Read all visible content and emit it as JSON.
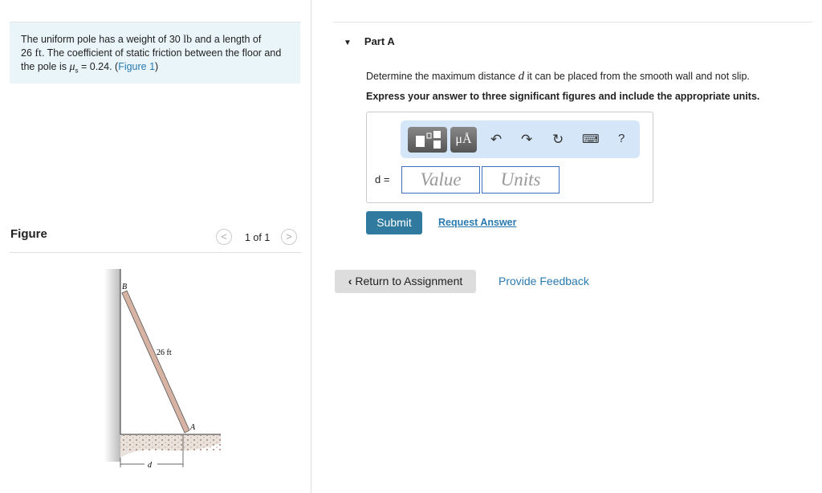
{
  "problem": {
    "p1": "The uniform pole has a weight of 30 ",
    "u1": "lb",
    "p2": " and a length of ",
    "p3": "26 ",
    "u2": "ft",
    "p4": ". The coefficient of static friction between the floor and the pole is ",
    "mu": "μ",
    "sub": "s",
    "p5": " = 0.24. (",
    "figlink": "Figure 1",
    "p6": ")"
  },
  "figure": {
    "label": "Figure",
    "pager": "1 of 1",
    "prev": "<",
    "next": ">",
    "labels": {
      "b": "B",
      "a": "A",
      "length": "26 ft",
      "d": "d"
    }
  },
  "part": {
    "title": "Part A",
    "question_pre": "Determine the maximum distance ",
    "var": "d",
    "question_post": " it can be placed from the smooth wall and not slip.",
    "instruction": "Express your answer to three significant figures and include the appropriate units."
  },
  "answer": {
    "var_label": "d =",
    "value_placeholder": "Value",
    "units_placeholder": "Units",
    "toolbar": {
      "units_btn": "μÅ",
      "undo": "↶",
      "redo": "↷",
      "reset": "↻",
      "keyboard": "⌨",
      "help": "?"
    }
  },
  "buttons": {
    "submit": "Submit",
    "request": "Request Answer",
    "return": "Return to Assignment",
    "return_icon": "‹",
    "feedback": "Provide Feedback"
  },
  "colors": {
    "accent": "#2f7a9e",
    "link": "#2a7ab0",
    "problem_bg": "#eaf5f9"
  }
}
